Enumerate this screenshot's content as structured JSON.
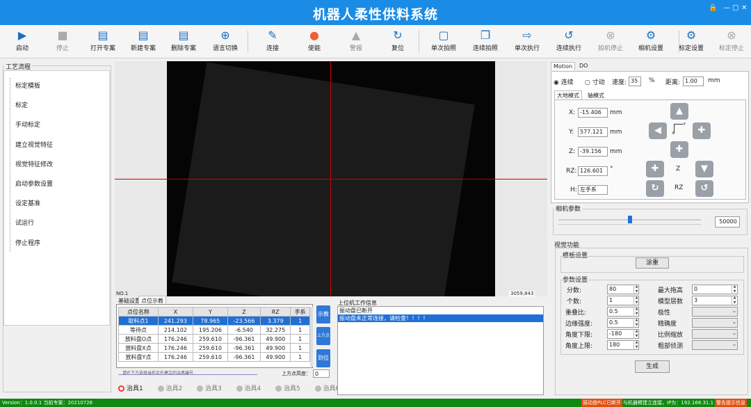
{
  "app": {
    "title": "机器人柔性供料系统",
    "win_pin": "🔒",
    "win_min": "—",
    "win_max": "▢",
    "win_close": "✕"
  },
  "toolbar": [
    {
      "label": "启动",
      "icon": "▶",
      "name": "start-button",
      "dis": false
    },
    {
      "label": "停止",
      "icon": "■",
      "name": "stop-button",
      "dis": true
    },
    {
      "label": "打开专案",
      "icon": "▤",
      "name": "open-project-button",
      "dis": false
    },
    {
      "label": "新建专案",
      "icon": "▤",
      "name": "new-project-button",
      "dis": false
    },
    {
      "label": "删除专案",
      "icon": "▤",
      "name": "delete-project-button",
      "dis": false
    },
    {
      "label": "语言切换",
      "icon": "⊕",
      "name": "language-switch-button",
      "dis": false
    },
    {
      "label": "连接",
      "icon": "✎",
      "name": "connect-button",
      "dis": false
    },
    {
      "label": "使能",
      "icon": "●",
      "name": "enable-button",
      "dis": false
    },
    {
      "label": "警报",
      "icon": "▲",
      "name": "alarm-button",
      "dis": true
    },
    {
      "label": "复位",
      "icon": "↻",
      "name": "reset-button",
      "dis": false
    },
    {
      "label": "单次拍照",
      "icon": "▢",
      "name": "single-capture-button",
      "dis": false
    },
    {
      "label": "连续拍照",
      "icon": "❐",
      "name": "continuous-capture-button",
      "dis": false
    },
    {
      "label": "单次执行",
      "icon": "⇨",
      "name": "single-execute-button",
      "dis": false
    },
    {
      "label": "连续执行",
      "icon": "↺",
      "name": "continuous-execute-button",
      "dis": false
    },
    {
      "label": "拍机停止",
      "icon": "⊗",
      "name": "camera-stop-button",
      "dis": true
    },
    {
      "label": "相机设置",
      "icon": "⚙",
      "name": "camera-settings-button",
      "dis": false
    },
    {
      "label": "标定设置",
      "icon": "⚙",
      "name": "calibration-settings-button",
      "dis": false
    },
    {
      "label": "标定停止",
      "icon": "⊗",
      "name": "calibration-stop-button",
      "dis": true
    }
  ],
  "process": {
    "title": "工艺流程",
    "items": [
      "标定模板",
      "标定",
      "手动标定",
      "建立视觉特征",
      "视觉特征修改",
      "启动参数设置",
      "设定基准",
      "试运行",
      "停止程序"
    ]
  },
  "viewer": {
    "label": "NO.1",
    "coords": "3059,843"
  },
  "points": {
    "tabs": [
      "基础设置",
      "点位示教"
    ],
    "headers": [
      "点位名称",
      "X",
      "Y",
      "Z",
      "RZ",
      "手系"
    ],
    "rows": [
      [
        "取料点1",
        "241.293",
        "78.965",
        "-23.566",
        "3.379",
        "1"
      ],
      [
        "等待点",
        "214.102",
        "195.206",
        "-6.540",
        "32.275",
        "1"
      ],
      [
        "放料盘O点",
        "176.246",
        "259.610",
        "-96.361",
        "49.900",
        "1"
      ],
      [
        "放料盘X点",
        "176.246",
        "259.610",
        "-96.361",
        "49.900",
        "1"
      ],
      [
        "放料盘Y点",
        "176.246",
        "259.610",
        "-96.361",
        "49.900",
        "1"
      ]
    ],
    "hint": "请在下方选择当前正在建立的治具编号",
    "height_label": "上方点高度：",
    "height_value": "0",
    "btn_teach": "示教",
    "btn_up": "上方点",
    "btn_goto": "到位"
  },
  "log": {
    "title": "上位机工作信息",
    "lines": [
      "振动盘已断开",
      "振动盘未正常连接，请检查！！！！"
    ]
  },
  "fixtures": [
    "治具1",
    "治具2",
    "治具3",
    "治具4",
    "治具5",
    "治具6"
  ],
  "motion": {
    "tabs": [
      "Motion",
      "DO"
    ],
    "mode_cont": "连续",
    "mode_jog": "寸动",
    "speed_label": "速度:",
    "speed": "35",
    "speed_unit": "%",
    "dist_label": "距离:",
    "dist": "1.00",
    "dist_unit": "mm",
    "subtabs": [
      "大地模式",
      "轴模式"
    ],
    "x_label": "X:",
    "x": "-15.406",
    "y_label": "Y:",
    "y": "577.121",
    "z_label": "Z:",
    "z": "-39.156",
    "rz_label": "RZ:",
    "rz": "126.601",
    "mm": "mm",
    "deg": "°",
    "h_label": "H:",
    "h": "左手系",
    "z_text": "Z",
    "rz_text": "RZ",
    "axis_x": "X",
    "axis_y": "Y"
  },
  "camera": {
    "title": "相机参数",
    "value": "50000",
    "slider": 0.5
  },
  "vision": {
    "title": "视觉功能",
    "template_title": "模板设置",
    "template_btn": "涂重",
    "params_title": "参数设置",
    "left": [
      {
        "l": "分数:",
        "v": "80"
      },
      {
        "l": "个数:",
        "v": "1"
      },
      {
        "l": "重叠比:",
        "v": "0.5"
      },
      {
        "l": "边缘强度:",
        "v": "0.5"
      },
      {
        "l": "角度下限:",
        "v": "-180"
      },
      {
        "l": "角度上限:",
        "v": "180"
      }
    ],
    "right": [
      {
        "l": "最大拖高",
        "v": "0"
      },
      {
        "l": "模型层数",
        "v": "3"
      },
      {
        "l": "极性",
        "v": ""
      },
      {
        "l": "精确度",
        "v": ""
      },
      {
        "l": "比例缩放",
        "v": ""
      },
      {
        "l": "粗部侦测",
        "v": ""
      }
    ],
    "gen_btn": "生成"
  },
  "status": {
    "version": "Version：1.0.0.1  当前专案：20210726",
    "warn": "振动盘PLC已断开",
    "info": "与机器臂建立连接，IP为：192.168.31.1",
    "warn2": "警告提示信息"
  }
}
